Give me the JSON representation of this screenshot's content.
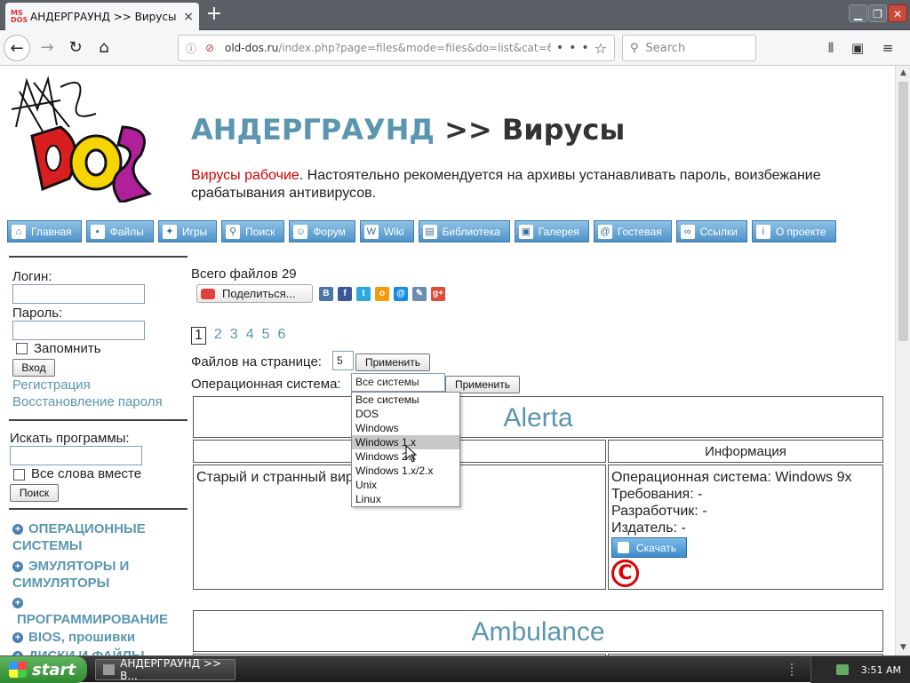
{
  "browser": {
    "tab_title": "АНДЕРГРАУНД >> Вирусы - Ста",
    "tab_close": "×",
    "new_tab": "+",
    "url_domain": "old-dos.ru",
    "url_path": "/index.php?page=files&mode=files&do=list&cat=6",
    "url_actions": "•••",
    "search_placeholder": "Search"
  },
  "header": {
    "crumb": "АНДЕРГРАУНД",
    "separator": " >> ",
    "title": "Вирусы",
    "desc_red": "Вирусы рабочие",
    "desc_rest": ". Настоятельно рекомендуется на архивы устанавливать пароль, воизбежание срабатывания антивирусов."
  },
  "nav": [
    {
      "label": "Главная",
      "icon": "home-icon",
      "glyph": "⌂"
    },
    {
      "label": "Файлы",
      "icon": "terminal-icon",
      "glyph": "▪"
    },
    {
      "label": "Игры",
      "icon": "invader-icon",
      "glyph": "✦"
    },
    {
      "label": "Поиск",
      "icon": "magnifier-icon",
      "glyph": "⚲"
    },
    {
      "label": "Форум",
      "icon": "user-icon",
      "glyph": "☺"
    },
    {
      "label": "Wiki",
      "icon": "wiki-icon",
      "glyph": "W"
    },
    {
      "label": "Библиотека",
      "icon": "book-icon",
      "glyph": "▤"
    },
    {
      "label": "Галерея",
      "icon": "picture-icon",
      "glyph": "▣"
    },
    {
      "label": "Гостевая",
      "icon": "guestbook-icon",
      "glyph": "@"
    },
    {
      "label": "Ссылки",
      "icon": "link-icon",
      "glyph": "∞"
    },
    {
      "label": "О проекте",
      "icon": "info-icon",
      "glyph": "i"
    }
  ],
  "sidebar": {
    "login_label": "Логин:",
    "password_label": "Пароль:",
    "remember_label": "Запомнить",
    "enter_button": "Вход",
    "register_link": "Регистрация",
    "restore_link": "Восстановление пароля",
    "search_label": "Искать программы:",
    "all_words_label": "Все слова вместе",
    "search_button": "Поиск",
    "categories": [
      "ОПЕРАЦИОННЫЕ СИСТЕМЫ",
      "ЭМУЛЯТОРЫ И СИМУЛЯТОРЫ",
      "ПРОГРАММИРОВАНИЕ",
      "BIOS, прошивки",
      "ДИСКИ И ФАЙЛЫ"
    ]
  },
  "main": {
    "total": "Всего файлов 29",
    "share_button": "Поделиться...",
    "socials": [
      {
        "name": "vk-icon",
        "glyph": "B",
        "color": "#4a76a8"
      },
      {
        "name": "facebook-icon",
        "glyph": "f",
        "color": "#3b5998"
      },
      {
        "name": "twitter-icon",
        "glyph": "t",
        "color": "#2aa9e0"
      },
      {
        "name": "odnoklassniki-icon",
        "glyph": "o",
        "color": "#f59a0b"
      },
      {
        "name": "mailru-icon",
        "glyph": "@",
        "color": "#168de2"
      },
      {
        "name": "livejournal-icon",
        "glyph": "✎",
        "color": "#6a8cb0"
      },
      {
        "name": "googleplus-icon",
        "glyph": "g+",
        "color": "#dd4b39"
      }
    ],
    "pages": [
      "1",
      "2",
      "3",
      "4",
      "5",
      "6"
    ],
    "current_page": "1",
    "per_page_label": "Файлов на странице:",
    "per_page_value": "5",
    "apply_button": "Применить",
    "os_label": "Операционная система:",
    "os_selected": "Все системы",
    "os_options": [
      "Все системы",
      "DOS",
      "Windows",
      "Windows 1.x",
      "Windows 2.x",
      "Windows 1.x/2.x",
      "Unix",
      "Linux"
    ],
    "os_highlighted": "Windows 1.x",
    "file1": {
      "title": "Alerta",
      "info_header": "Информация",
      "description": "Старый и странный вирус",
      "os_line": "Операционная система: Windows 9x",
      "req_line": "Требования: -",
      "dev_line": "Разработчик: -",
      "pub_line": "Издатель: -",
      "download_button": "Скачать",
      "copyright_mark": "C"
    },
    "file2": {
      "title": "Ambulance"
    }
  },
  "taskbar": {
    "start": "start",
    "item": "АНДЕРГРАУНД >> В...",
    "clock": "3:51 AM"
  }
}
